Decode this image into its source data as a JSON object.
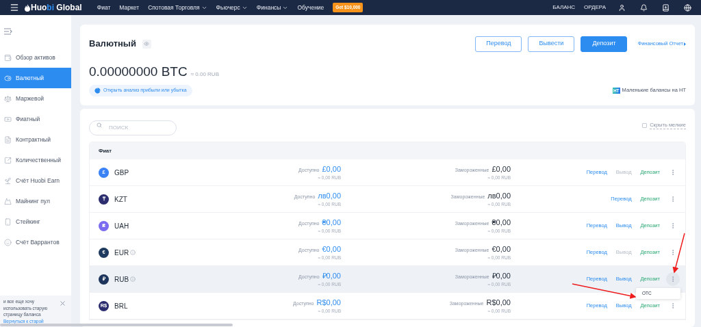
{
  "nav": {
    "logo": {
      "main": "Huo",
      "accent": "bi",
      "rest": " Global"
    },
    "items": [
      {
        "label": "Фиат",
        "dropdown": false
      },
      {
        "label": "Маркет",
        "dropdown": false
      },
      {
        "label": "Спотовая Торговля",
        "dropdown": true
      },
      {
        "label": "Фьючерс",
        "dropdown": true
      },
      {
        "label": "Финансы",
        "dropdown": true
      },
      {
        "label": "Обучение",
        "dropdown": false
      }
    ],
    "promo": "Get $10,000",
    "right_links": [
      "БАЛАНС",
      "ОРДЕРА"
    ]
  },
  "sidebar": {
    "items": [
      {
        "label": "Обзор активов",
        "selected": false
      },
      {
        "label": "Валютный",
        "selected": true
      },
      {
        "label": "Маржевой",
        "selected": false
      },
      {
        "label": "Фиатный",
        "selected": false
      },
      {
        "label": "Контрактный",
        "selected": false
      },
      {
        "label": "Количественный",
        "selected": false
      },
      {
        "label": "Счёт Huobi Earn",
        "selected": false
      },
      {
        "label": "Майнинг пул",
        "selected": false
      },
      {
        "label": "Стейкинг",
        "selected": false
      },
      {
        "label": "Счёт Варрантов",
        "selected": false
      }
    ],
    "notice": {
      "text": "и все еще хочу использовать старую страницу баланса",
      "link": "Вернуться к старой"
    }
  },
  "summary": {
    "title": "Валютный",
    "buttons": [
      {
        "label": "Перевод",
        "kind": "outline"
      },
      {
        "label": "Вывести",
        "kind": "outline"
      },
      {
        "label": "Депозит",
        "kind": "primary"
      }
    ],
    "report_link": "Финансовый Отчет",
    "balance": "0.00000000 BTC",
    "balance_fiat": "≈ 0.00 RUB",
    "analysis_button": "Открыть анализ прибыли или убытка",
    "ht_badge": "HT",
    "ht_link": "Маленькие балансы на HT"
  },
  "assets": {
    "search": {
      "placeholder": "ПОИСК"
    },
    "hide_small": {
      "label": "Скрыть мелкие",
      "checked": false
    },
    "section": "Фиат",
    "rows": [
      {
        "code": "GBP",
        "symbol": "£",
        "color": "#3b82f6",
        "info": false,
        "selected": false,
        "available_label": "Доступно",
        "available": "£0,00",
        "available_fiat": "≈ 0,00 RUB",
        "frozen_label": "Замороженные",
        "frozen": "£0,00",
        "frozen_fiat": "≈ 0,00 RUB",
        "transfer": "Перевод",
        "withdraw": {
          "label": "Вывод",
          "disabled": true
        },
        "deposit": "Депозит"
      },
      {
        "code": "KZT",
        "symbol": "₸",
        "color": "#2b2d6e",
        "info": false,
        "selected": false,
        "available_label": "Доступно",
        "available": "лв0,00",
        "available_fiat": "≈ 0,00 RUB",
        "frozen_label": "Замороженные",
        "frozen": "лв0,00",
        "frozen_fiat": "≈ 0,00 RUB",
        "transfer": "Перевод",
        "deposit": "Депозит"
      },
      {
        "code": "UAH",
        "symbol": "₴",
        "color": "#7b6cf0",
        "info": false,
        "selected": false,
        "available_label": "Доступно",
        "available": "₴0,00",
        "available_fiat": "≈ 0,00 RUB",
        "frozen_label": "Замороженные",
        "frozen": "₴0,00",
        "frozen_fiat": "≈ 0,00 RUB",
        "transfer": "Перевод",
        "withdraw": {
          "label": "Вывод",
          "disabled": false
        },
        "deposit": "Депозит"
      },
      {
        "code": "EUR",
        "symbol": "€",
        "color": "#1e3a5f",
        "info": true,
        "selected": false,
        "available_label": "Доступно",
        "available": "€0,00",
        "available_fiat": "≈ 0,00 RUB",
        "frozen_label": "Замороженные",
        "frozen": "€0,00",
        "frozen_fiat": "≈ 0,00 RUB",
        "transfer": "Перевод",
        "withdraw": {
          "label": "Вывод",
          "disabled": true
        },
        "deposit": "Депозит"
      },
      {
        "code": "RUB",
        "symbol": "₽",
        "color": "#1d355c",
        "info": true,
        "selected": true,
        "available_label": "Доступно",
        "available": "₽0,00",
        "available_fiat": "≈ 0,00 RUB",
        "frozen_label": "Замороженные",
        "frozen": "₽0,00",
        "frozen_fiat": "≈ 0,00 RUB",
        "transfer": "Перевод",
        "withdraw": {
          "label": "Вывод",
          "disabled": false
        },
        "deposit": "Депозит",
        "menu": [
          "OTC"
        ]
      },
      {
        "code": "BRL",
        "symbol": "R$",
        "color": "#2b2d6e",
        "info": false,
        "selected": false,
        "available_label": "Доступно",
        "available": "R$0,00",
        "available_fiat": "≈ 0,00 RUB",
        "frozen_label": "Замороженные",
        "frozen": "R$0,00",
        "frozen_fiat": "≈ 0,00 RUB",
        "transfer": "Перевод",
        "withdraw": {
          "label": "Вывод",
          "disabled": false
        },
        "deposit": "Депозит"
      }
    ]
  }
}
